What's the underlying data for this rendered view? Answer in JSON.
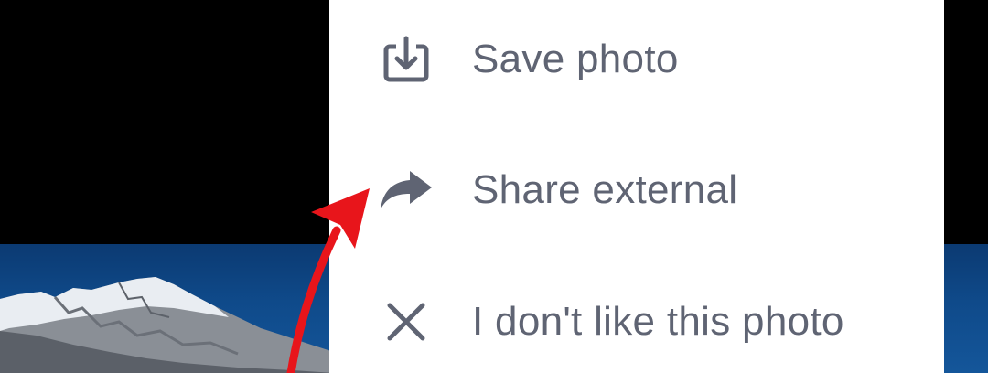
{
  "menu": {
    "items": [
      {
        "label": "Save photo",
        "icon": "download-icon"
      },
      {
        "label": "Share external",
        "icon": "share-arrow-icon"
      },
      {
        "label": "I don't like this photo",
        "icon": "close-icon"
      }
    ]
  },
  "colors": {
    "menu_background": "#ffffff",
    "menu_text": "#5f6473",
    "menu_icon": "#5f6473",
    "annotation_arrow": "#e8151b",
    "photo_sky": "#0f4a8a"
  }
}
